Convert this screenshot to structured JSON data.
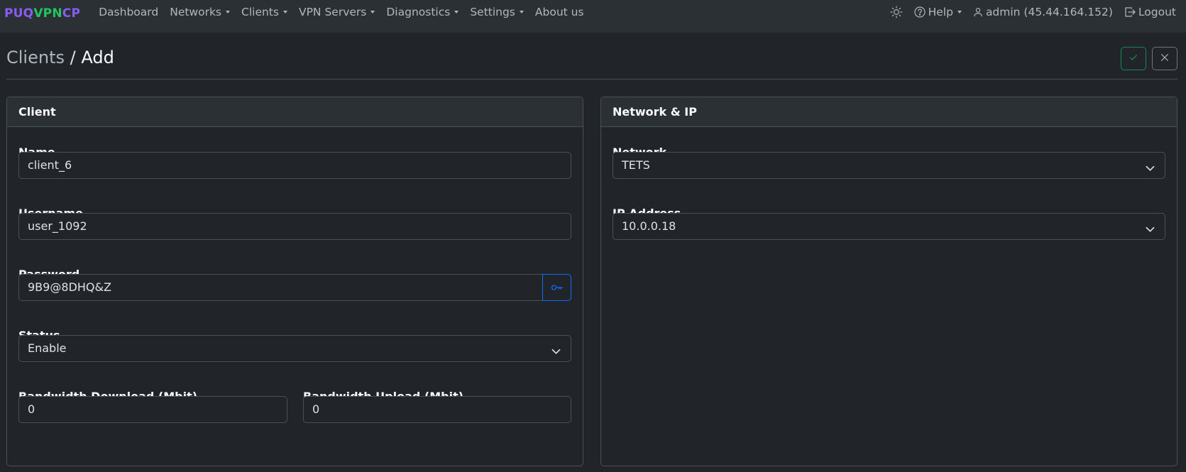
{
  "brand": {
    "part1": "PUQ",
    "part2": "VPN",
    "part3": "CP"
  },
  "nav": {
    "items": [
      {
        "label": "Dashboard",
        "dropdown": false
      },
      {
        "label": "Networks",
        "dropdown": true
      },
      {
        "label": "Clients",
        "dropdown": true
      },
      {
        "label": "VPN Servers",
        "dropdown": true
      },
      {
        "label": "Diagnostics",
        "dropdown": true
      },
      {
        "label": "Settings",
        "dropdown": true
      },
      {
        "label": "About us",
        "dropdown": false
      }
    ],
    "right": {
      "theme_icon": "sun-icon",
      "help_label": "Help",
      "user_label": "admin (45.44.164.152)",
      "logout_label": "Logout"
    }
  },
  "page": {
    "breadcrumb_parent": "Clients",
    "separator": "/",
    "breadcrumb_current": "Add"
  },
  "client_card": {
    "title": "Client",
    "name_label": "Name",
    "name_value": "client_6",
    "username_label": "Username",
    "username_value": "user_1092",
    "password_label": "Password",
    "password_value": "9B9@8DHQ&Z",
    "status_label": "Status",
    "status_value": "Enable",
    "bw_download_label": "Bandwidth Download (Mbit)",
    "bw_download_value": "0",
    "bw_upload_label": "Bandwidth Upload (Mbit)",
    "bw_upload_value": "0"
  },
  "network_card": {
    "title": "Network & IP",
    "network_label": "Network",
    "network_value": "TETS",
    "ip_label": "IP Address",
    "ip_value": "10.0.0.18"
  },
  "colors": {
    "brand_purple": "#8a5cf6",
    "brand_green": "#22c55e",
    "save_green": "#198754",
    "primary_blue": "#0d6efd",
    "background": "#212529",
    "navbar": "#2b3035"
  }
}
